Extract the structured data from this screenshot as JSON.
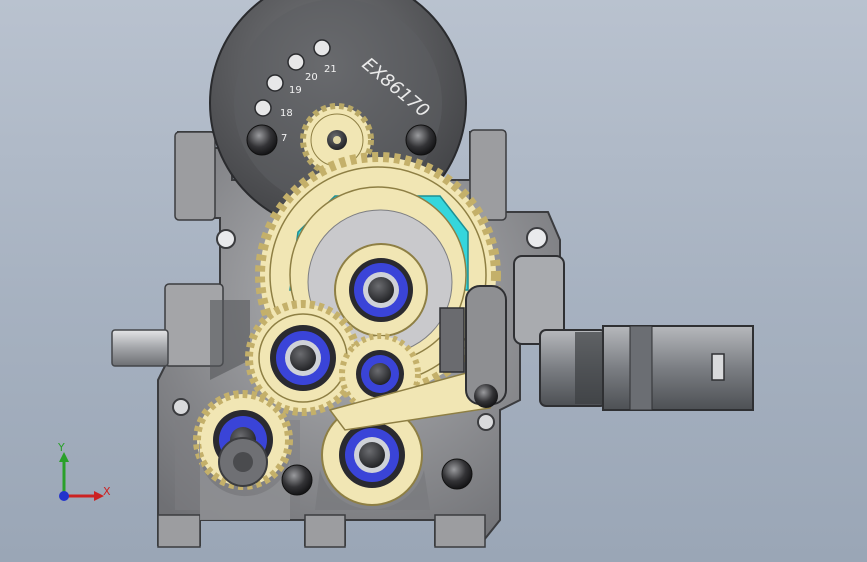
{
  "viewport": {
    "background_top": "#b9c2cf",
    "background_bottom": "#9aa6b6"
  },
  "model": {
    "cover_text": "EX86170",
    "hole_numbers": [
      "21",
      "20",
      "19",
      "18",
      "7"
    ],
    "colors": {
      "housing": "#8e8f92",
      "housing_dark": "#4a4b4e",
      "cover": "#5a5b5e",
      "gear_cream": "#f1e6b4",
      "gear_edge": "#b9a866",
      "bearing_blue": "#3a44d8",
      "bearing_ring": "#2a2a30",
      "cyan_plate": "#35d6dc",
      "connector": "#8a8d92"
    },
    "icons": [
      "bolt-head-icon",
      "bearing-icon",
      "connector-latch-icon"
    ]
  },
  "triad": {
    "y_label": "Y",
    "x_label": "X",
    "y_color": "#2aa02a",
    "x_color": "#cc2222",
    "z_color": "#2233cc"
  }
}
